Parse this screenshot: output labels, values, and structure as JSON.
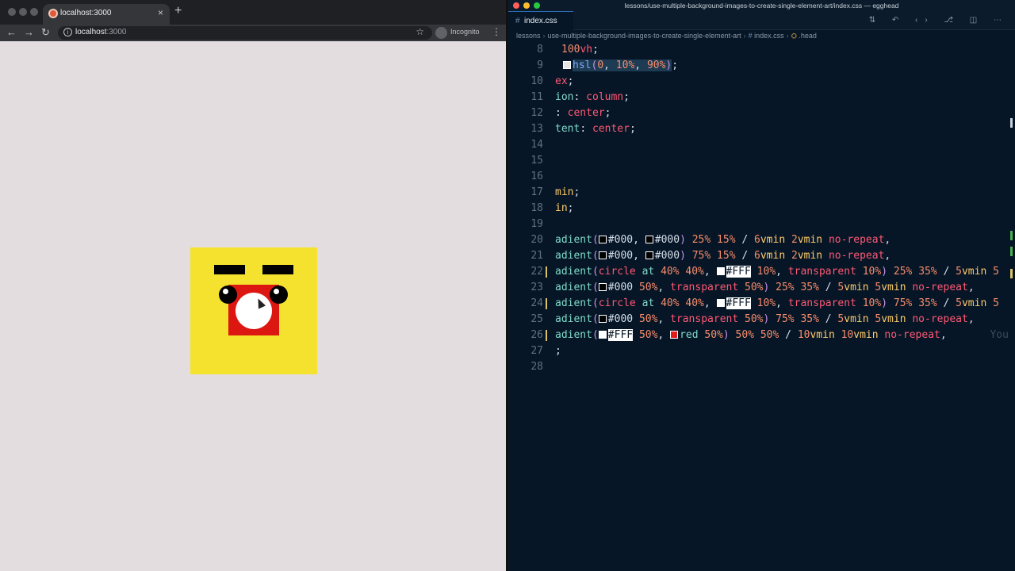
{
  "browser": {
    "tab_title": "localhost:3000",
    "tab_close": "×",
    "new_tab": "+",
    "url_host": "localhost",
    "url_port": ":3000",
    "incognito_label": "Incognito",
    "back_icon": "←",
    "forward_icon": "→",
    "reload_icon": "↻",
    "star_icon": "☆",
    "menu_icon": "⋮"
  },
  "editor": {
    "window_title": "lessons/use-multiple-background-images-to-create-single-element-art/index.css — egghead",
    "tab_label": "index.css",
    "breadcrumb": [
      "lessons",
      "use-multiple-background-images-to-create-single-element-art",
      "index.css",
      ".head"
    ],
    "actions": "⇅ ↶ ‹› ⎇ ◫ ⋯"
  },
  "code_lines": [
    {
      "num": "8"
    },
    {
      "num": "9"
    },
    {
      "num": "10"
    },
    {
      "num": "11"
    },
    {
      "num": "12"
    },
    {
      "num": "13"
    },
    {
      "num": "14"
    },
    {
      "num": "15"
    },
    {
      "num": "16"
    },
    {
      "num": "17"
    },
    {
      "num": "18"
    },
    {
      "num": "19"
    },
    {
      "num": "20"
    },
    {
      "num": "21"
    },
    {
      "num": "22"
    },
    {
      "num": "23"
    },
    {
      "num": "24"
    },
    {
      "num": "25"
    },
    {
      "num": "26"
    },
    {
      "num": "27"
    },
    {
      "num": "28"
    }
  ],
  "colors": {
    "page_bg": "#e3dde0",
    "art_yellow": "#f5e22e",
    "art_red": "#dc1610",
    "editor_bg": "#061626"
  }
}
